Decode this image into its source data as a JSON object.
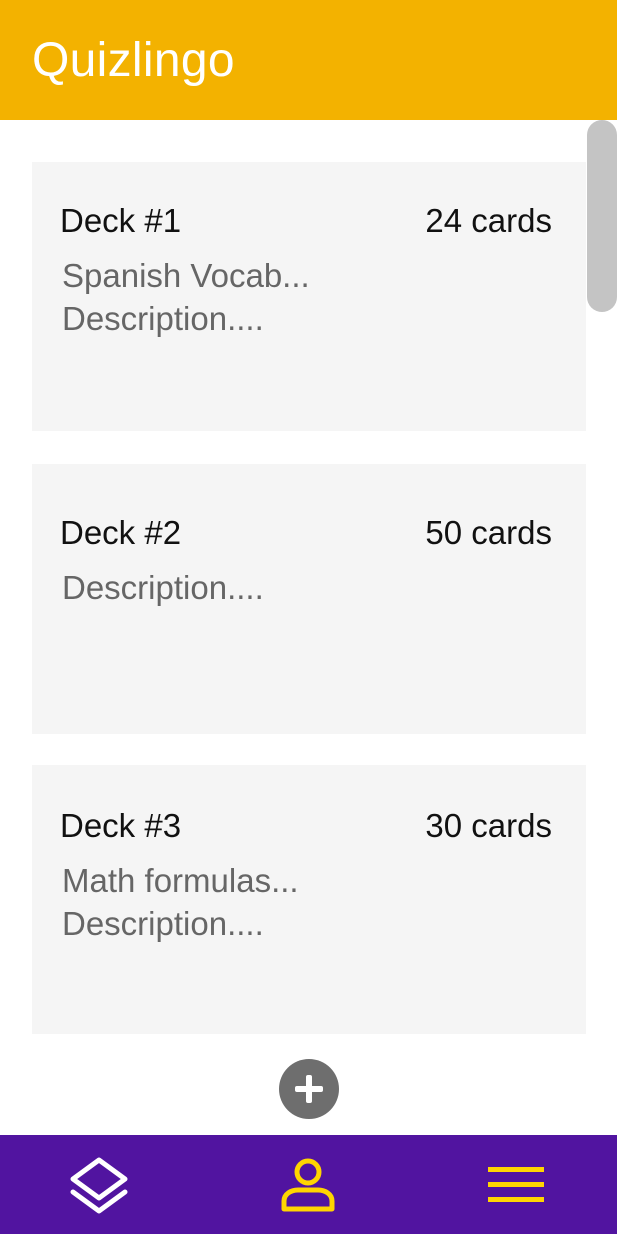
{
  "app": {
    "title": "Quizlingo"
  },
  "decks": [
    {
      "title": "Deck #1",
      "count": "24 cards",
      "subtitle": "Spanish Vocab...",
      "description": "Description...."
    },
    {
      "title": "Deck #2",
      "count": "50 cards",
      "subtitle": "",
      "description": "Description...."
    },
    {
      "title": "Deck #3",
      "count": "30 cards",
      "subtitle": "Math formulas...",
      "description": "Description...."
    }
  ],
  "add_button": {
    "icon": "plus-icon"
  },
  "bottom_nav": {
    "items": [
      {
        "icon": "layers-icon",
        "active": true
      },
      {
        "icon": "profile-icon",
        "active": false
      },
      {
        "icon": "menu-icon",
        "active": false
      }
    ]
  },
  "colors": {
    "header": "#F3B200",
    "nav": "#5114A0",
    "nav_icon_active": "#FFFFFF",
    "nav_icon": "#FFD500",
    "card": "#F5F5F5",
    "add_button": "#6E6E6E"
  }
}
